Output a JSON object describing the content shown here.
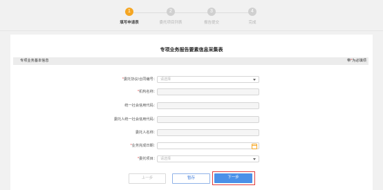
{
  "stepper": {
    "steps": [
      {
        "num": "1",
        "label": "填写申请表",
        "active": true
      },
      {
        "num": "2",
        "label": "委托项目列表",
        "active": false
      },
      {
        "num": "3",
        "label": "报告提交",
        "active": false
      },
      {
        "num": "4",
        "label": "完成",
        "active": false
      }
    ]
  },
  "form": {
    "title": "专项业务报告要素信息采集表",
    "section": {
      "title": "专项业务基本信息",
      "required_note_prefix": "带",
      "required_note_star": "*",
      "required_note_suffix": "为必填项"
    },
    "fields": [
      {
        "label": "委托协议/合同编号：",
        "required": true,
        "type": "select",
        "placeholder": "请选择"
      },
      {
        "label": "机构名称：",
        "required": true,
        "type": "text",
        "placeholder": ""
      },
      {
        "label": "统一社会信用代码：",
        "required": false,
        "type": "text",
        "placeholder": ""
      },
      {
        "label": "委托人统一社会信用代码：",
        "required": false,
        "type": "text",
        "placeholder": ""
      },
      {
        "label": "委托人名称：",
        "required": false,
        "type": "text",
        "placeholder": ""
      },
      {
        "label": "业务完成日期：",
        "required": true,
        "type": "date",
        "placeholder": ""
      },
      {
        "label": "委托项目：",
        "required": true,
        "type": "select",
        "placeholder": "请选择"
      }
    ]
  },
  "buttons": {
    "prev": "上一步",
    "save": "暂存",
    "next": "下一步"
  },
  "colors": {
    "active_step": "#f5a623",
    "primary": "#4b91e8",
    "required": "#e03b3b",
    "highlight_border": "#e03b3b"
  }
}
